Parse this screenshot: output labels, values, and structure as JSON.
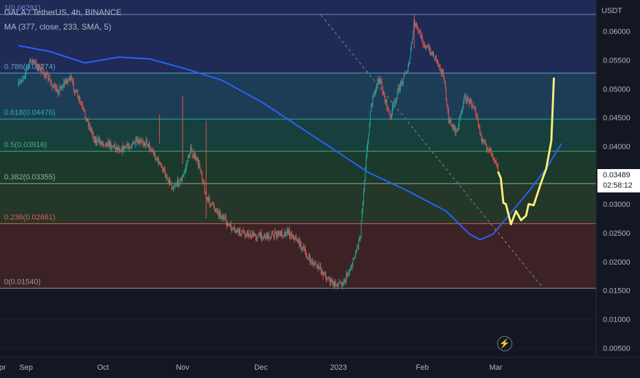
{
  "header": {
    "symbol_line": "GALA / TetherUS, 4h, BINANCE",
    "indicator_line": "MA (377, close, 233, SMA, 5)"
  },
  "price_axis": {
    "unit": "USDT",
    "last_price": "0.03489",
    "countdown": "02:58:12"
  },
  "icons": {
    "replay": "flash-icon"
  },
  "colors": {
    "background": "#131722",
    "up": "#26a69a",
    "down": "#ef5350",
    "ma": "#2962ff",
    "projection": "#f5f07a",
    "trendline": "#787b86"
  },
  "chart_data": {
    "type": "candlestick",
    "title": "GALA / TetherUS, 4h, BINANCE",
    "ylabel": "USDT",
    "ylim": [
      0.0035,
      0.064
    ],
    "x_ticks": [
      "Sep",
      "Oct",
      "Nov",
      "Dec",
      "2023",
      "Feb",
      "Mar",
      "Apr"
    ],
    "y_ticks": [
      "0.06000",
      "0.05500",
      "0.05000",
      "0.04500",
      "0.04000",
      "0.03500",
      "0.03000",
      "0.02500",
      "0.02000",
      "0.01500",
      "0.01000",
      "0.00500"
    ],
    "fib_levels": [
      {
        "label": "1(0.06291)",
        "value": 0.06291,
        "color": "#7e87d4",
        "fill": "#1f2a55"
      },
      {
        "label": "0.786(0.05274)",
        "value": 0.05274,
        "color": "#5aa6d6",
        "fill": "#1d3d56"
      },
      {
        "label": "0.618(0.04476)",
        "value": 0.04476,
        "color": "#24b392",
        "fill": "#173f3d"
      },
      {
        "label": "0.5(0.03916)",
        "value": 0.03916,
        "color": "#46b46e",
        "fill": "#1b3a2c"
      },
      {
        "label": "0.382(0.03355)",
        "value": 0.03355,
        "color": "#9db08f",
        "fill": "#243728"
      },
      {
        "label": "0.236(0.02661)",
        "value": 0.02661,
        "color": "#e45e5e",
        "fill": "#3c2224"
      },
      {
        "label": "0(0.01540)",
        "value": 0.0154,
        "color": "#9598a1",
        "fill": "#131722"
      }
    ],
    "price_path": [
      [
        "Aug 29",
        0.0505
      ],
      [
        "Sep 3",
        0.055
      ],
      [
        "Sep 8",
        0.0528
      ],
      [
        "Sep 13",
        0.0495
      ],
      [
        "Sep 18",
        0.052
      ],
      [
        "Sep 23",
        0.0465
      ],
      [
        "Sep 28",
        0.041
      ],
      [
        "Oct 3",
        0.0405
      ],
      [
        "Oct 8",
        0.0395
      ],
      [
        "Oct 13",
        0.0405
      ],
      [
        "Oct 18",
        0.0408
      ],
      [
        "Oct 23",
        0.037
      ],
      [
        "Oct 28",
        0.033
      ],
      [
        "Nov 1",
        0.0345
      ],
      [
        "Nov 4",
        0.0395
      ],
      [
        "Nov 8",
        0.036
      ],
      [
        "Nov 10",
        0.031
      ],
      [
        "Nov 14",
        0.029
      ],
      [
        "Nov 20",
        0.0255
      ],
      [
        "Nov 28",
        0.0245
      ],
      [
        "Dec 5",
        0.0245
      ],
      [
        "Dec 12",
        0.0252
      ],
      [
        "Dec 16",
        0.0235
      ],
      [
        "Dec 20",
        0.0205
      ],
      [
        "Dec 25",
        0.0185
      ],
      [
        "Dec 30",
        0.016
      ],
      [
        "Jan 3",
        0.0165
      ],
      [
        "Jan 6",
        0.0195
      ],
      [
        "Jan 9",
        0.0245
      ],
      [
        "Jan 11",
        0.037
      ],
      [
        "Jan 13",
        0.047
      ],
      [
        "Jan 16",
        0.052
      ],
      [
        "Jan 20",
        0.045
      ],
      [
        "Jan 24",
        0.051
      ],
      [
        "Jan 27",
        0.054
      ],
      [
        "Jan 29",
        0.0615
      ],
      [
        "Feb 2",
        0.0575
      ],
      [
        "Feb 6",
        0.0555
      ],
      [
        "Feb 9",
        0.0525
      ],
      [
        "Feb 11",
        0.0445
      ],
      [
        "Feb 14",
        0.0425
      ],
      [
        "Feb 17",
        0.0485
      ],
      [
        "Feb 21",
        0.047
      ],
      [
        "Feb 24",
        0.0405
      ],
      [
        "Feb 27",
        0.0395
      ],
      [
        "Mar 1",
        0.0375
      ],
      [
        "Mar 2",
        0.0355
      ]
    ],
    "ma_path": [
      [
        "Aug 29",
        0.0575
      ],
      [
        "Sep 10",
        0.0565
      ],
      [
        "Sep 24",
        0.0545
      ],
      [
        "Oct 7",
        0.0555
      ],
      [
        "Oct 19",
        0.0552
      ],
      [
        "Nov 2",
        0.0535
      ],
      [
        "Nov 16",
        0.0515
      ],
      [
        "Dec 1",
        0.0478
      ],
      [
        "Dec 16",
        0.0435
      ],
      [
        "Dec 30",
        0.0395
      ],
      [
        "Jan 12",
        0.0355
      ],
      [
        "Jan 27",
        0.0322
      ],
      [
        "Feb 10",
        0.0288
      ],
      [
        "Feb 19",
        0.0248
      ],
      [
        "Feb 23",
        0.0238
      ],
      [
        "Feb 28",
        0.0248
      ],
      [
        "Mar 7",
        0.0285
      ],
      [
        "Mar 14",
        0.0322
      ],
      [
        "Mar 21",
        0.0362
      ],
      [
        "Mar 27",
        0.0405
      ],
      [
        "Apr 2",
        0.0432
      ]
    ],
    "projection_path": [
      [
        "Mar 2",
        0.0355
      ],
      [
        "Mar 3",
        0.0345
      ],
      [
        "Mar 4",
        0.0302
      ],
      [
        "Mar 5",
        0.03
      ],
      [
        "Mar 7",
        0.0265
      ],
      [
        "Mar 9",
        0.0288
      ],
      [
        "Mar 11",
        0.0272
      ],
      [
        "Mar 13",
        0.028
      ],
      [
        "Mar 14",
        0.03
      ],
      [
        "Mar 16",
        0.0298
      ],
      [
        "Mar 19",
        0.0338
      ],
      [
        "Mar 21",
        0.0362
      ],
      [
        "Mar 23",
        0.041
      ],
      [
        "Mar 24",
        0.0518
      ]
    ],
    "trendline": [
      [
        "Dec 25",
        0.0628
      ],
      [
        "Mar 19",
        0.0158
      ]
    ]
  }
}
